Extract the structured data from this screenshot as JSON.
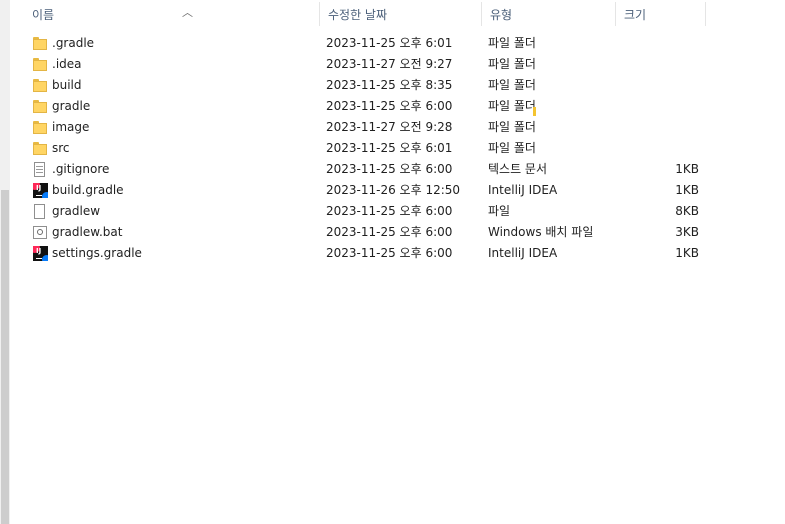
{
  "header": {
    "name": "이름",
    "date": "수정한 날짜",
    "type": "유형",
    "size": "크기"
  },
  "files": [
    {
      "name": ".gradle",
      "date": "2023-11-25 오후 6:01",
      "type": "파일 폴더",
      "size": "",
      "icon": "folder-icon"
    },
    {
      "name": ".idea",
      "date": "2023-11-27 오전 9:27",
      "type": "파일 폴더",
      "size": "",
      "icon": "folder-icon"
    },
    {
      "name": "build",
      "date": "2023-11-25 오후 8:35",
      "type": "파일 폴더",
      "size": "",
      "icon": "folder-icon"
    },
    {
      "name": "gradle",
      "date": "2023-11-25 오후 6:00",
      "type": "파일 폴더",
      "size": "",
      "icon": "folder-icon"
    },
    {
      "name": "image",
      "date": "2023-11-27 오전 9:28",
      "type": "파일 폴더",
      "size": "",
      "icon": "folder-icon"
    },
    {
      "name": "src",
      "date": "2023-11-25 오후 6:01",
      "type": "파일 폴더",
      "size": "",
      "icon": "folder-icon"
    },
    {
      "name": ".gitignore",
      "date": "2023-11-25 오후 6:00",
      "type": "텍스트 문서",
      "size": "1KB",
      "icon": "text-file-icon"
    },
    {
      "name": "build.gradle",
      "date": "2023-11-26 오후 12:50",
      "type": "IntelliJ IDEA",
      "size": "1KB",
      "icon": "intellij-idea-icon"
    },
    {
      "name": "gradlew",
      "date": "2023-11-25 오후 6:00",
      "type": "파일",
      "size": "8KB",
      "icon": "blank-file-icon"
    },
    {
      "name": "gradlew.bat",
      "date": "2023-11-25 오후 6:00",
      "type": "Windows 배치 파일",
      "size": "3KB",
      "icon": "batch-file-icon"
    },
    {
      "name": "settings.gradle",
      "date": "2023-11-25 오후 6:00",
      "type": "IntelliJ IDEA",
      "size": "1KB",
      "icon": "intellij-idea-icon"
    }
  ]
}
